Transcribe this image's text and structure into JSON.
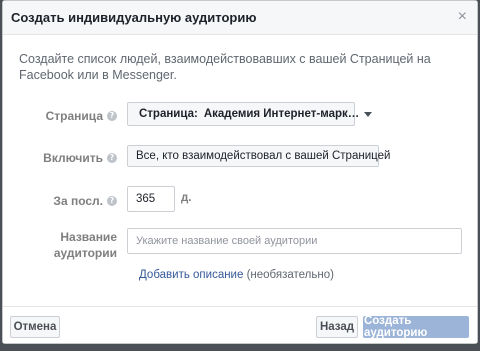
{
  "dialog": {
    "title": "Создать индивидуальную аудиторию",
    "close_glyph": "×"
  },
  "intro_text": "Создайте список людей, взаимодействовавших с вашей Страницей на Facebook или в Messenger.",
  "page_field": {
    "label": "Страница",
    "help_glyph": "?",
    "value_prefix": "Страница:",
    "value_name": "Академия Интернет-марк…",
    "page_icon": "page-flag-icon"
  },
  "include_field": {
    "label": "Включить",
    "help_glyph": "?",
    "value": "Все, кто взаимодействовал с вашей Страницей"
  },
  "days_field": {
    "label": "За посл.",
    "help_glyph": "?",
    "value": "365",
    "unit": "д."
  },
  "name_field": {
    "label": "Название аудитории",
    "placeholder": "Укажите название своей аудитории"
  },
  "description": {
    "link_text": "Добавить описание",
    "optional_text": " (необязательно)"
  },
  "footer": {
    "cancel_label": "Отмена",
    "back_label": "Назад",
    "create_label": "Создать аудиторию"
  },
  "colors": {
    "link": "#365899",
    "primary_disabled": "#9cb4d8",
    "label_gray": "#7f7f7f",
    "page_icon_orange": "#e8782a"
  }
}
